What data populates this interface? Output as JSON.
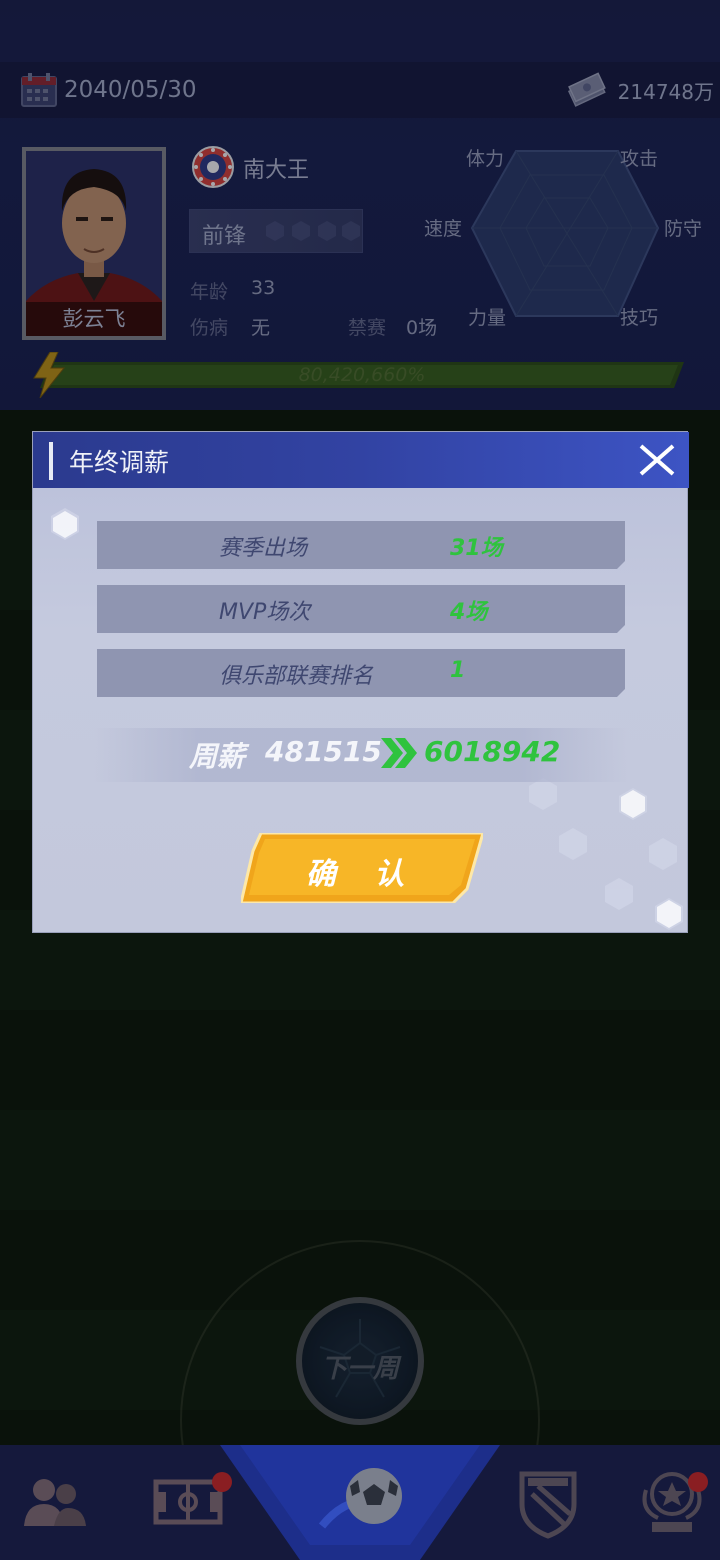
{
  "status_bar": {
    "date": "2040/05/30",
    "money": "214748万"
  },
  "player": {
    "name": "彭云飞",
    "club": "南大王",
    "position": "前锋",
    "age_label": "年龄",
    "age": "33",
    "injury_label": "伤病",
    "injury": "无",
    "ban_label": "禁赛",
    "ban": "0场",
    "radar_labels": [
      "体力",
      "攻击",
      "防守",
      "技巧",
      "力量",
      "速度"
    ],
    "energy_text": "80,420,660%"
  },
  "dialog": {
    "title": "年终调薪",
    "stats": [
      {
        "label": "赛季出场",
        "value": "31场"
      },
      {
        "label": "MVP场次",
        "value": "4场"
      },
      {
        "label": "俱乐部联赛排名",
        "value": "1"
      }
    ],
    "salary_label": "周薪",
    "salary_old": "481515",
    "salary_new": "6018942",
    "confirm": "确 认"
  },
  "next_week": "下一周",
  "colors": {
    "accent_green": "#2fc33e",
    "header_blue": "#3243a3",
    "confirm_yellow": "#f5b221"
  },
  "nav_icons": [
    "team-icon",
    "pitch-icon",
    "football-icon",
    "club-crest-icon",
    "trophy-icon"
  ]
}
